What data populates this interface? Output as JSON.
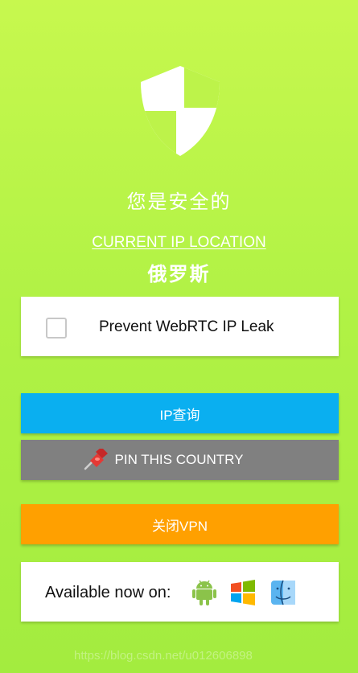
{
  "colors": {
    "background_top": "#c7f84e",
    "background_bottom": "#a3ec3f",
    "ip_button": "#0aaff0",
    "pin_button": "#808080",
    "vpn_button": "#ffa000",
    "text_light": "#ffffff"
  },
  "status": {
    "icon": "shield-icon",
    "message": "您是安全的"
  },
  "location": {
    "link_label": "CURRENT IP LOCATION",
    "country": "俄罗斯"
  },
  "webrtc": {
    "checked": false,
    "label": "Prevent WebRTC IP Leak"
  },
  "buttons": {
    "ip_lookup": "IP查询",
    "pin_country": "PIN THIS COUNTRY",
    "pin_icon": "pushpin-icon",
    "close_vpn": "关闭VPN"
  },
  "platforms": {
    "label": "Available now on:",
    "icons": [
      "android-icon",
      "windows-icon",
      "mac-finder-icon"
    ]
  },
  "watermark": "https://blog.csdn.net/u012606898"
}
